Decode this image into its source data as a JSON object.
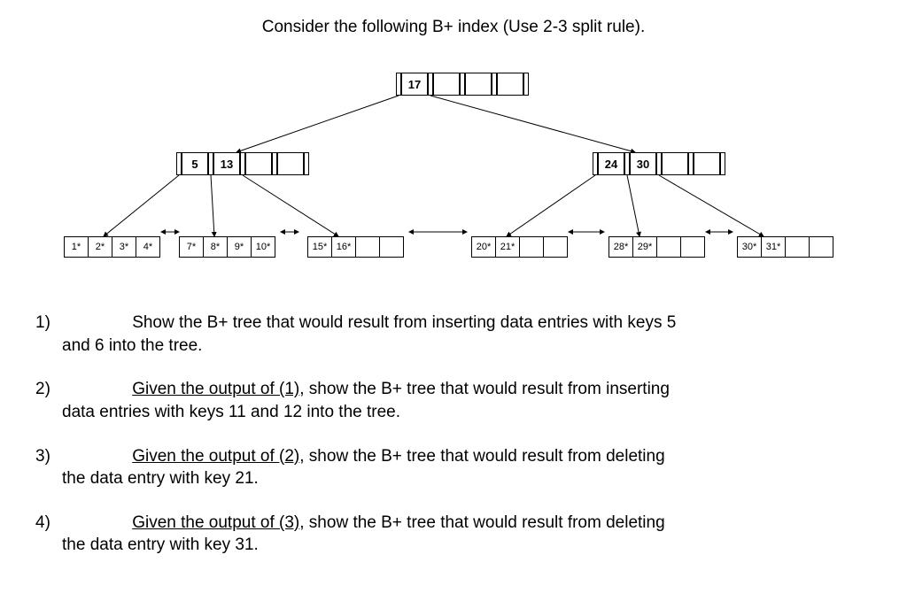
{
  "title": "Consider the following B+ index (Use 2-3 split rule).",
  "tree": {
    "root": {
      "keys": [
        "17",
        "",
        "",
        ""
      ]
    },
    "internal": [
      {
        "keys": [
          "5",
          "13",
          "",
          ""
        ]
      },
      {
        "keys": [
          "24",
          "30",
          "",
          ""
        ]
      }
    ],
    "leaves": [
      {
        "vals": [
          "1*",
          "2*",
          "3*",
          "4*"
        ]
      },
      {
        "vals": [
          "7*",
          "8*",
          "9*",
          "10*"
        ]
      },
      {
        "vals": [
          "15*",
          "16*",
          "",
          ""
        ]
      },
      {
        "vals": [
          "20*",
          "21*",
          "",
          ""
        ]
      },
      {
        "vals": [
          "28*",
          "29*",
          "",
          ""
        ]
      },
      {
        "vals": [
          "30*",
          "31*",
          "",
          ""
        ]
      }
    ]
  },
  "questions": [
    {
      "num": "1)",
      "pre": "",
      "link": "",
      "post": "Show the B+ tree that would result from inserting data entries with keys 5",
      "cont": "and 6 into the tree."
    },
    {
      "num": "2)",
      "pre": "",
      "link": "Given the output of (1)",
      "post": ", show the B+ tree that would result from inserting",
      "cont": "data entries with keys 11 and 12 into the tree."
    },
    {
      "num": "3)",
      "pre": "",
      "link": "Given the output of (2)",
      "post": ", show the B+ tree that would result from deleting",
      "cont": "the data entry with key 21."
    },
    {
      "num": "4)",
      "pre": "",
      "link": "Given the output of (3)",
      "post": ", show the B+ tree that would result from deleting",
      "cont": "the data entry with key 31."
    }
  ]
}
